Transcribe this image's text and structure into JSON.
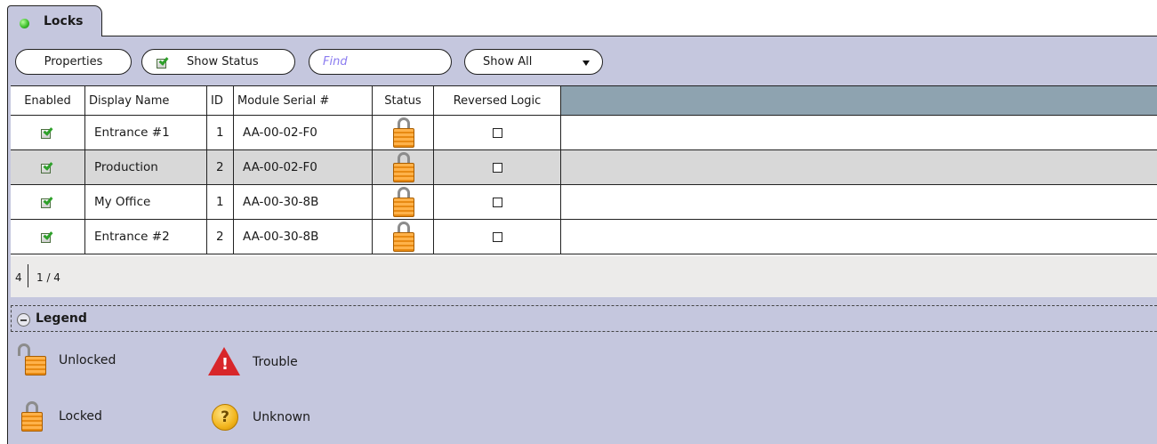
{
  "tab": {
    "title": "Locks",
    "status_dot": "green"
  },
  "toolbar": {
    "properties_label": "Properties",
    "show_status_label": "Show Status",
    "show_status_checked": true,
    "find_placeholder": "Find",
    "filter_value": "Show All"
  },
  "grid": {
    "columns": [
      "Enabled",
      "Display Name",
      "ID",
      "Module Serial #",
      "Status",
      "Reversed Logic"
    ],
    "rows": [
      {
        "enabled": true,
        "display_name": "Entrance #1",
        "id": "1",
        "serial": "AA-00-02-F0",
        "status": "locked",
        "reversed_logic": false
      },
      {
        "enabled": true,
        "display_name": "Production",
        "id": "2",
        "serial": "AA-00-02-F0",
        "status": "locked",
        "reversed_logic": false,
        "selected": true
      },
      {
        "enabled": true,
        "display_name": "My Office",
        "id": "1",
        "serial": "AA-00-30-8B",
        "status": "locked",
        "reversed_logic": false
      },
      {
        "enabled": true,
        "display_name": "Entrance #2",
        "id": "2",
        "serial": "AA-00-30-8B",
        "status": "locked",
        "reversed_logic": false
      }
    ]
  },
  "pager": {
    "count": "4",
    "pages": "1 / 4"
  },
  "legend": {
    "title": "Legend",
    "items": {
      "unlocked": "Unlocked",
      "locked": "Locked",
      "trouble": "Trouble",
      "unknown": "Unknown"
    }
  },
  "colors": {
    "panel": "#c5c7de",
    "header": "#8ea3b0",
    "selected_row": "#d8d8d8",
    "lock": "#f5a02a"
  }
}
